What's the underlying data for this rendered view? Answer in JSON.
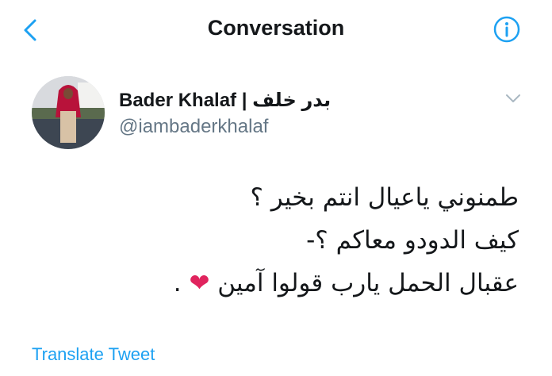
{
  "header": {
    "title": "Conversation",
    "back_icon": "chevron-left-icon",
    "info_icon": "info-circle-icon"
  },
  "tweet": {
    "author_name": "Bader Khalaf | بدر خلف",
    "author_handle": "@iambaderkhalaf",
    "menu_icon": "chevron-down-icon",
    "lines": [
      "طمنوني ياعيال انتم بخير ؟",
      "كيف الدودو معاكم ؟-",
      "عقبال الحمل يارب قولوا آمين"
    ],
    "emoji_heart": "❤",
    "trailing_dot": ".",
    "translate_label": "Translate Tweet"
  },
  "colors": {
    "accent": "#1da1f2",
    "text": "#14171a",
    "secondary": "#657786",
    "heart": "#e0245e"
  }
}
